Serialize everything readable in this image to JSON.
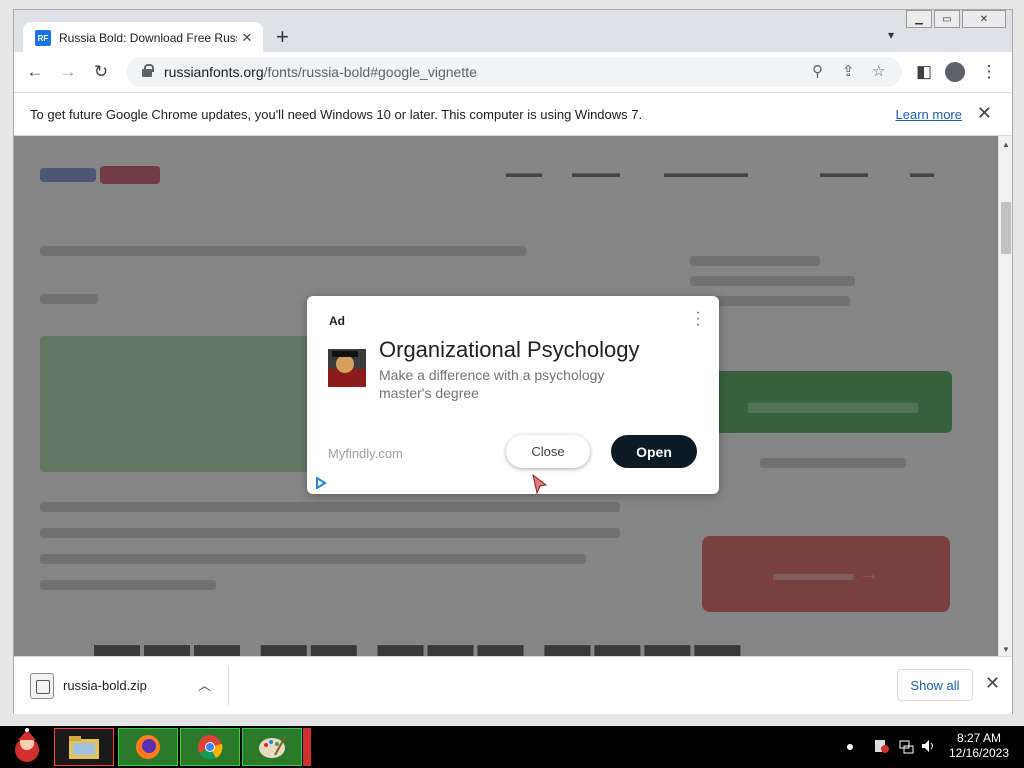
{
  "browser": {
    "tab": {
      "favicon": "RF",
      "title": "Russia Bold: Download Free Russ"
    },
    "address": {
      "domain": "russianfonts.org",
      "path": "/fonts/russia-bold#google_vignette"
    },
    "infobar": {
      "message": "To get future Google Chrome updates, you'll need Windows 10 or later. This computer is using Windows 7.",
      "link": "Learn more"
    }
  },
  "ad": {
    "label": "Ad",
    "title": "Organizational Psychology",
    "description": "Make a difference with a psychology master's degree",
    "domain": "Myfindly.com",
    "close_label": "Close",
    "open_label": "Open"
  },
  "downloads": {
    "filename": "russia-bold.zip",
    "show_all": "Show all"
  },
  "taskbar": {
    "time": "8:27 AM",
    "date": "12/16/2023"
  },
  "colors": {
    "ad_open_button": "#0b1a24",
    "link": "#1a5fb4",
    "download_green": "#2e9e3c",
    "next_red": "#de4748"
  }
}
